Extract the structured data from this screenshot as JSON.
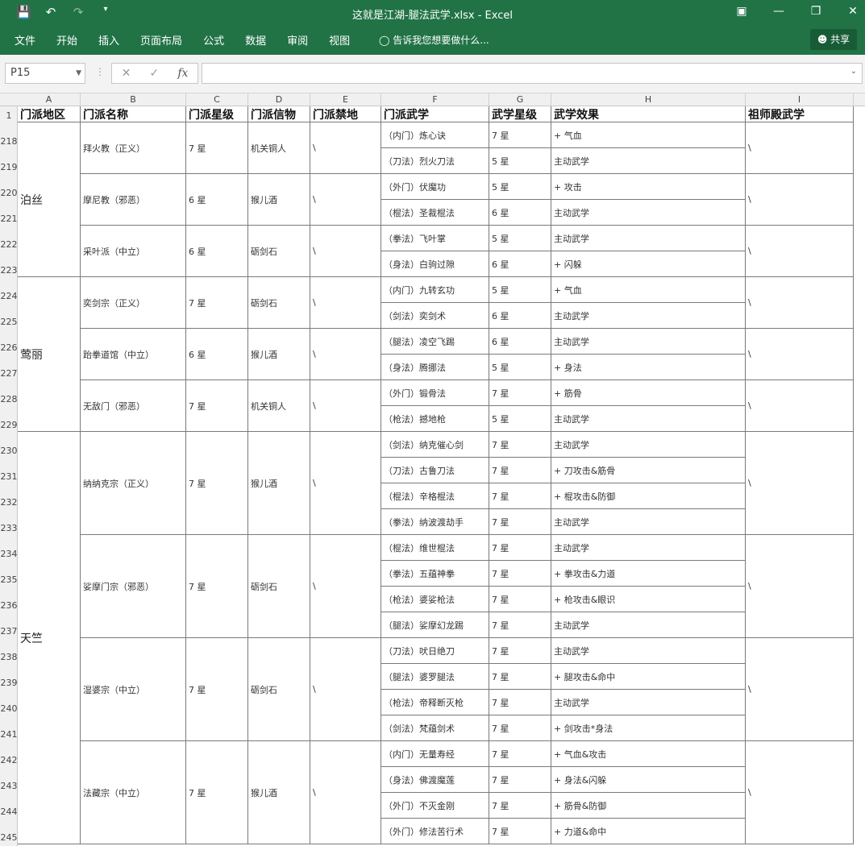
{
  "window": {
    "title": "这就是江湖-腿法武学.xlsx - Excel"
  },
  "ribbon": {
    "tabs": [
      "文件",
      "开始",
      "插入",
      "页面布局",
      "公式",
      "数据",
      "审阅",
      "视图"
    ],
    "tell_me": "告诉我您想要做什么...",
    "share": "共享"
  },
  "formula_bar": {
    "name_box": "P15",
    "formula": ""
  },
  "sheet": {
    "columns": [
      "A",
      "B",
      "C",
      "D",
      "E",
      "F",
      "G",
      "H",
      "I"
    ],
    "header_row_number": "1",
    "headers": [
      "门派地区",
      "门派名称",
      "门派星级",
      "门派信物",
      "门派禁地",
      "门派武学",
      "武学星级",
      "武学效果",
      "祖师殿武学"
    ],
    "row_numbers": [
      "218",
      "219",
      "220",
      "221",
      "222",
      "223",
      "224",
      "225",
      "226",
      "227",
      "228",
      "229",
      "230",
      "231",
      "232",
      "233",
      "234",
      "235",
      "236",
      "237",
      "238",
      "239",
      "240",
      "241",
      "242",
      "243",
      "244",
      "245"
    ],
    "regions": [
      {
        "name": "泊丝",
        "span": 6
      },
      {
        "name": "莺丽",
        "span": 6
      },
      {
        "name": "天竺",
        "span": 16
      }
    ],
    "sects": [
      {
        "name": "拜火教（正义）",
        "star": "7 星",
        "token": "机关铜人",
        "forbidden": "\\",
        "patriarch": "\\",
        "span": 2
      },
      {
        "name": "摩尼教（邪恶）",
        "star": "6 星",
        "token": "猴儿酒",
        "forbidden": "\\",
        "patriarch": "\\",
        "span": 2
      },
      {
        "name": "采叶派（中立）",
        "star": "6 星",
        "token": "砺剑石",
        "forbidden": "\\",
        "patriarch": "\\",
        "span": 2
      },
      {
        "name": "奕剑宗（正义）",
        "star": "7 星",
        "token": "砺剑石",
        "forbidden": "\\",
        "patriarch": "\\",
        "span": 2
      },
      {
        "name": "跆拳道馆（中立）",
        "star": "6 星",
        "token": "猴儿酒",
        "forbidden": "\\",
        "patriarch": "\\",
        "span": 2
      },
      {
        "name": "无敌门（邪恶）",
        "star": "7 星",
        "token": "机关铜人",
        "forbidden": "\\",
        "patriarch": "\\",
        "span": 2
      },
      {
        "name": "纳纳克宗（正义）",
        "star": "7 星",
        "token": "猴儿酒",
        "forbidden": "\\",
        "patriarch": "\\",
        "span": 4
      },
      {
        "name": "娑摩门宗（邪恶）",
        "star": "7 星",
        "token": "砺剑石",
        "forbidden": "\\",
        "patriarch": "\\",
        "span": 4
      },
      {
        "name": "湿婆宗（中立）",
        "star": "7 星",
        "token": "砺剑石",
        "forbidden": "\\",
        "patriarch": "\\",
        "span": 4
      },
      {
        "name": "法藏宗（中立）",
        "star": "7 星",
        "token": "猴儿酒",
        "forbidden": "\\",
        "patriarch": "\\",
        "span": 4
      }
    ],
    "skills": [
      {
        "name": "（内门）炼心诀",
        "star": "7 星",
        "effect": "+ 气血"
      },
      {
        "name": "（刀法）烈火刀法",
        "star": "5 星",
        "effect": "主动武学"
      },
      {
        "name": "（外门）伏魔功",
        "star": "5 星",
        "effect": "+ 攻击"
      },
      {
        "name": "（棍法）圣裁棍法",
        "star": "6 星",
        "effect": "主动武学"
      },
      {
        "name": "（拳法）飞叶掌",
        "star": "5 星",
        "effect": "主动武学"
      },
      {
        "name": "（身法）白驹过隙",
        "star": "6 星",
        "effect": "+ 闪躲"
      },
      {
        "name": "（内门）九转玄功",
        "star": "5 星",
        "effect": "+ 气血"
      },
      {
        "name": "（剑法）奕剑术",
        "star": "6 星",
        "effect": "主动武学"
      },
      {
        "name": "（腿法）凌空飞踢",
        "star": "6 星",
        "effect": "主动武学"
      },
      {
        "name": "（身法）腾挪法",
        "star": "5 星",
        "effect": "+ 身法"
      },
      {
        "name": "（外门）锻骨法",
        "star": "7 星",
        "effect": "+ 筋骨"
      },
      {
        "name": "（枪法）撼地枪",
        "star": "5 星",
        "effect": "主动武学"
      },
      {
        "name": "（剑法）纳克催心剑",
        "star": "7 星",
        "effect": "主动武学"
      },
      {
        "name": "（刀法）古鲁刀法",
        "star": "7 星",
        "effect": "+ 刀攻击&筋骨"
      },
      {
        "name": "（棍法）辛格棍法",
        "star": "7 星",
        "effect": "+ 棍攻击&防御"
      },
      {
        "name": "（拳法）纳波渡劫手",
        "star": "7 星",
        "effect": "主动武学"
      },
      {
        "name": "（棍法）维世棍法",
        "star": "7 星",
        "effect": "主动武学"
      },
      {
        "name": "（拳法）五蕴神拳",
        "star": "7 星",
        "effect": "+ 拳攻击&力道"
      },
      {
        "name": "（枪法）婆娑枪法",
        "star": "7 星",
        "effect": "+ 枪攻击&眼识"
      },
      {
        "name": "（腿法）娑摩幻龙踢",
        "star": "7 星",
        "effect": "主动武学"
      },
      {
        "name": "（刀法）吠日绝刀",
        "star": "7 星",
        "effect": "主动武学"
      },
      {
        "name": "（腿法）婆罗腿法",
        "star": "7 星",
        "effect": "+ 腿攻击&命中"
      },
      {
        "name": "（枪法）帝释断灭枪",
        "star": "7 星",
        "effect": "主动武学"
      },
      {
        "name": "（剑法）梵蕴剑术",
        "star": "7 星",
        "effect": "+ 剑攻击*身法"
      },
      {
        "name": "（内门）无量寿经",
        "star": "7 星",
        "effect": "+ 气血&攻击"
      },
      {
        "name": "（身法）佛渡魔莲",
        "star": "7 星",
        "effect": "+ 身法&闪躲"
      },
      {
        "name": "（外门）不灭金刚",
        "star": "7 星",
        "effect": "+ 筋骨&防御"
      },
      {
        "name": "（外门）修法苦行术",
        "star": "7 星",
        "effect": "+ 力道&命中"
      }
    ]
  }
}
